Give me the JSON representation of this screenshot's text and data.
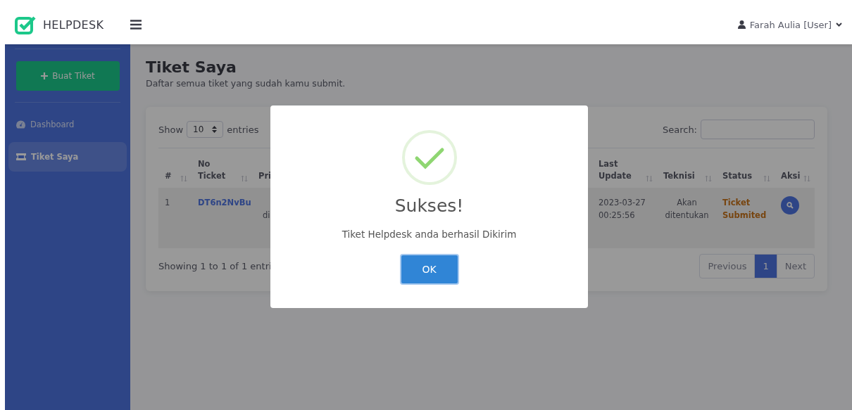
{
  "navbar": {
    "brand": "HELPDESK",
    "user": "Farah Aulia [User]"
  },
  "sidebar": {
    "create_button": "Buat Tiket",
    "items": [
      {
        "label": "Dashboard",
        "kind": "dashboard",
        "selected": false
      },
      {
        "label": "Tiket Saya",
        "kind": "ticket",
        "selected": true
      }
    ]
  },
  "page": {
    "title": "Tiket Saya",
    "subtitle": "Daftar semua tiket yang sudah kamu submit."
  },
  "table_controls": {
    "show_label": "Show",
    "entries_value": "10",
    "entries_label": "entries",
    "search_label": "Search:"
  },
  "table": {
    "columns": [
      {
        "label": "#"
      },
      {
        "label": "No Ticket"
      },
      {
        "label": "Pri"
      },
      {
        "label": "Last Update"
      },
      {
        "label": "Teknisi"
      },
      {
        "label": "Status"
      },
      {
        "label": "Aksi"
      }
    ],
    "rows": [
      {
        "cells": [
          {
            "text": "1",
            "kind": "plain"
          },
          {
            "text": "DT6n2NvBu",
            "kind": "link"
          },
          {
            "text": "di",
            "kind": "lower"
          },
          {
            "text": "2023-03-27 00:25:56",
            "kind": "plain"
          },
          {
            "text": "Akan ditentukan",
            "kind": "center"
          },
          {
            "text": "Ticket Submited",
            "kind": "status"
          },
          {
            "text": "",
            "kind": "action"
          }
        ]
      }
    ]
  },
  "table_footer": {
    "info": "Showing 1 to 1 of 1 entri",
    "pages": [
      {
        "label": "Previous",
        "selected": false
      },
      {
        "label": "1",
        "selected": true
      },
      {
        "label": "Next",
        "selected": false
      }
    ]
  },
  "modal": {
    "title": "Sukses!",
    "message": "Tiket Helpdesk anda berhasil Dikirim",
    "button": "OK"
  }
}
